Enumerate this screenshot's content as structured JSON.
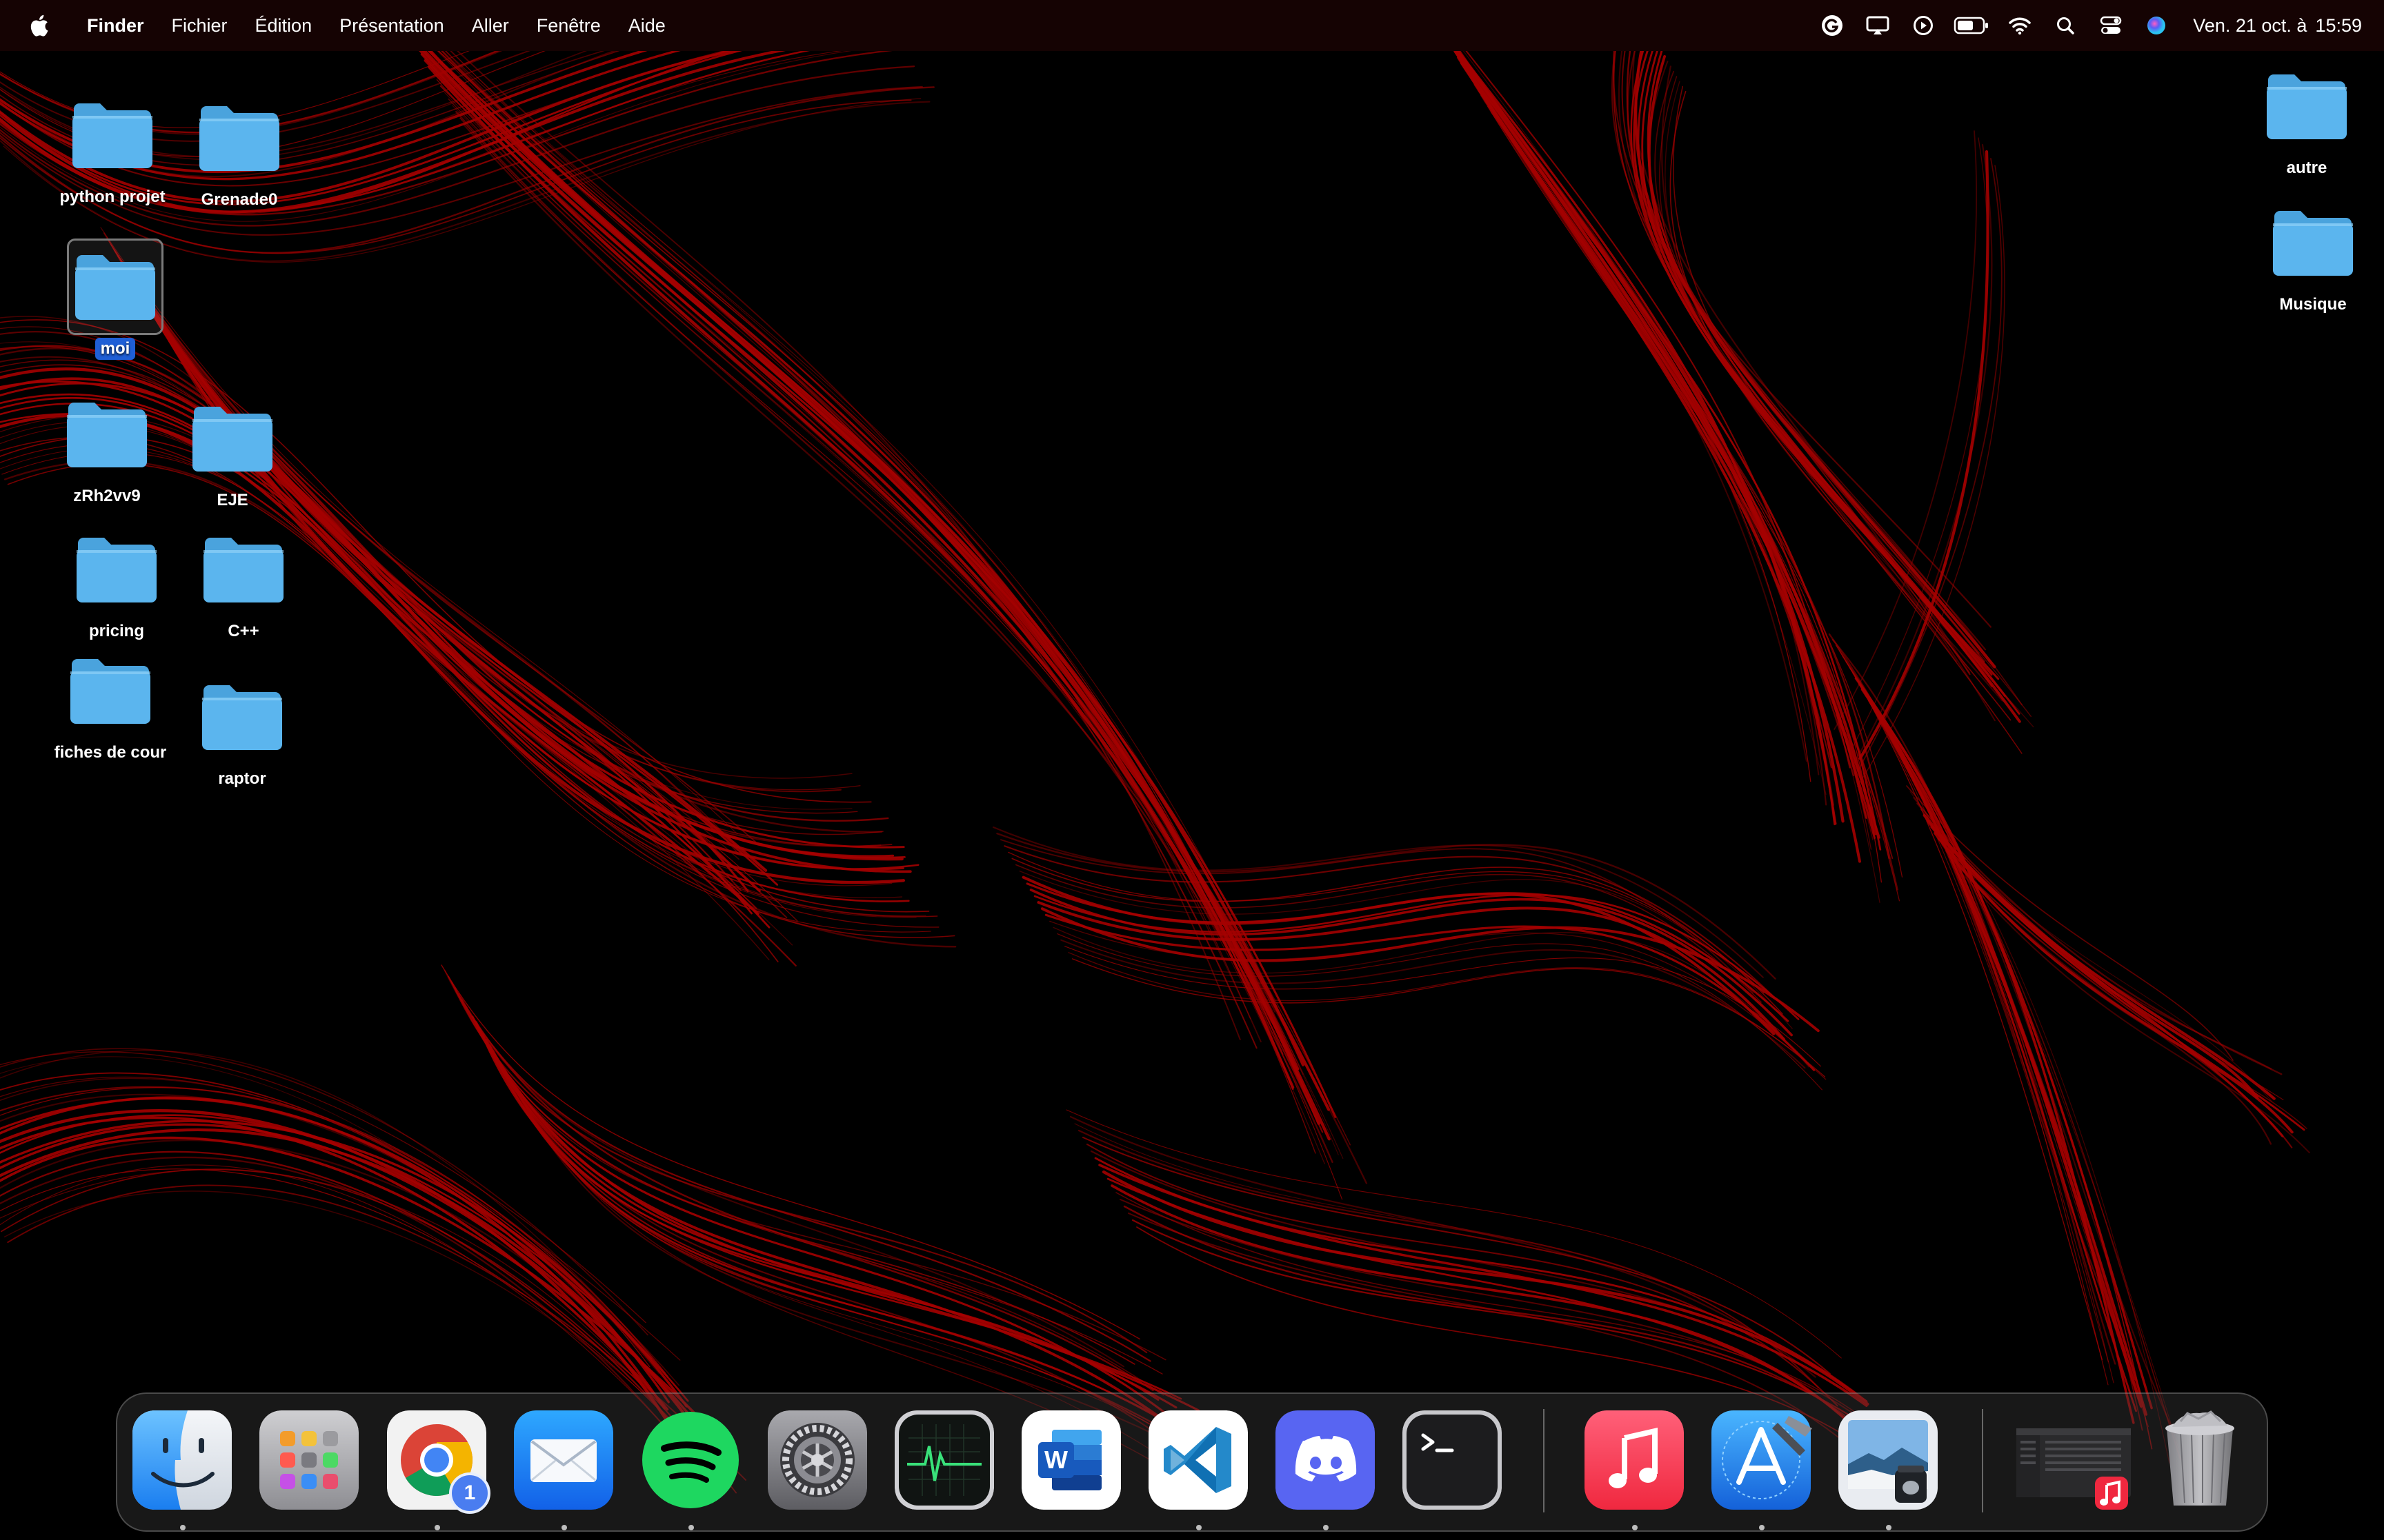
{
  "menubar": {
    "apple_icon": "apple-logo-icon",
    "app_name": "Finder",
    "items": [
      "Fichier",
      "Édition",
      "Présentation",
      "Aller",
      "Fenêtre",
      "Aide"
    ],
    "status_icons": [
      "grammarly-icon",
      "screen-mirroring-icon",
      "now-playing-icon",
      "battery-icon",
      "wifi-icon",
      "spotlight-search-icon",
      "control-center-icon",
      "siri-icon"
    ],
    "clock": {
      "date": "Ven. 21 oct. à",
      "time": "15:59"
    }
  },
  "desktop": {
    "left_icons": [
      {
        "label": "python projet",
        "selected": false
      },
      {
        "label": "Grenade0",
        "selected": false
      },
      {
        "label": "moi",
        "selected": true
      },
      {
        "label": "zRh2vv9",
        "selected": false
      },
      {
        "label": "EJE",
        "selected": false
      },
      {
        "label": "pricing",
        "selected": false
      },
      {
        "label": "C++",
        "selected": false
      },
      {
        "label": "fiches de cour",
        "selected": false
      },
      {
        "label": "raptor",
        "selected": false
      }
    ],
    "right_icons": [
      {
        "label": "autre"
      },
      {
        "label": "Musique"
      }
    ]
  },
  "dock": {
    "apps": [
      {
        "name": "Finder",
        "icon": "finder-icon",
        "running": true
      },
      {
        "name": "Launchpad",
        "icon": "launchpad-icon",
        "running": false
      },
      {
        "name": "Google Chrome",
        "icon": "chrome-icon",
        "running": true,
        "badge": "1"
      },
      {
        "name": "Mail",
        "icon": "mail-icon",
        "running": true
      },
      {
        "name": "Spotify",
        "icon": "spotify-icon",
        "running": true
      },
      {
        "name": "Préférences Système",
        "icon": "system-preferences-icon",
        "running": false
      },
      {
        "name": "Moniteur d'activité",
        "icon": "activity-monitor-icon",
        "running": false
      },
      {
        "name": "Microsoft Word",
        "icon": "word-icon",
        "running": false
      },
      {
        "name": "Visual Studio Code",
        "icon": "vscode-icon",
        "running": true
      },
      {
        "name": "Discord",
        "icon": "discord-icon",
        "running": true
      },
      {
        "name": "Terminal",
        "icon": "terminal-icon",
        "running": false
      },
      {
        "name": "Musique",
        "icon": "music-icon",
        "running": true
      },
      {
        "name": "Xcode",
        "icon": "xcode-icon",
        "running": true
      },
      {
        "name": "Aperçu",
        "icon": "preview-icon",
        "running": true
      },
      {
        "name": "Musique",
        "icon": "music-minimized-window-icon",
        "running": false
      },
      {
        "name": "Corbeille",
        "icon": "trash-icon",
        "running": false
      }
    ],
    "colors": {
      "folder": "#5bb5ee",
      "wallpaper_line": "#b10000",
      "selection": "#1f5fd6"
    }
  }
}
